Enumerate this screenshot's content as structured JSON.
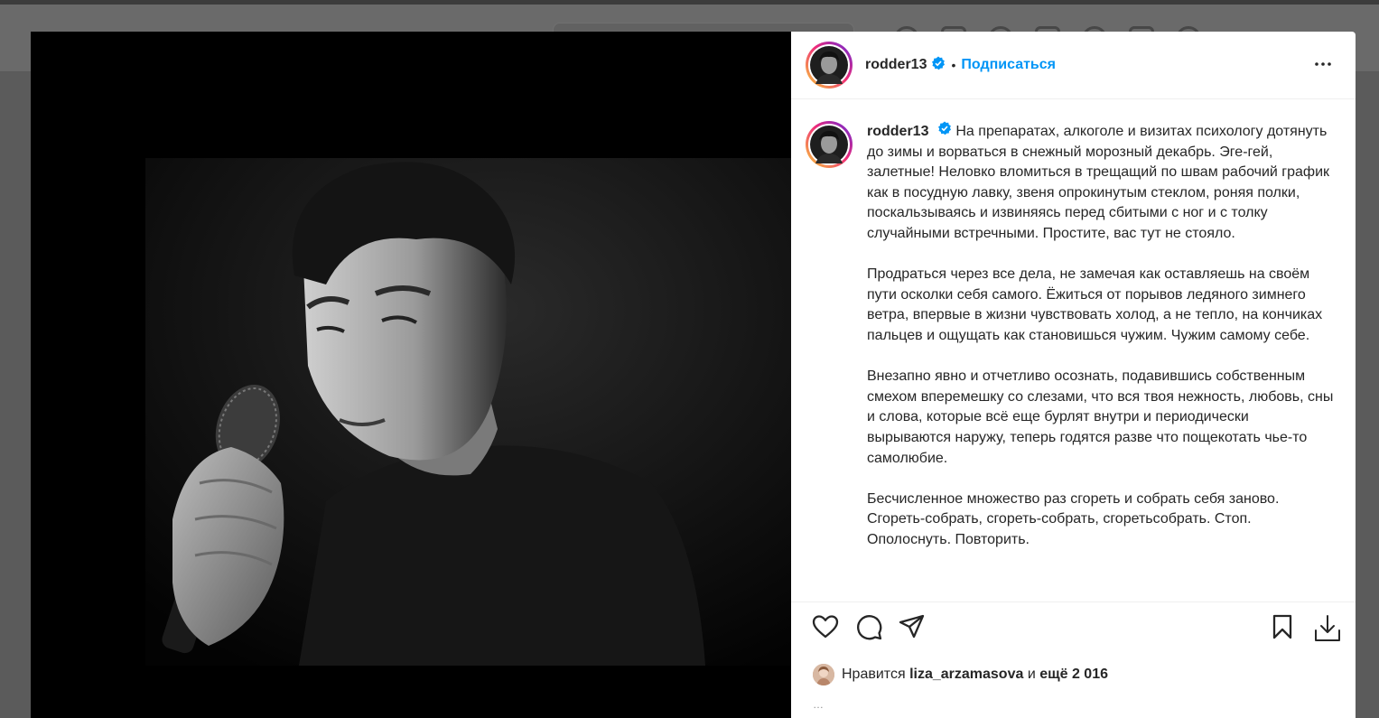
{
  "post": {
    "username": "rodder13",
    "separator": "•",
    "follow_label": "Подписаться",
    "caption_username": "rodder13",
    "caption_paragraphs": [
      "На препаратах, алкоголе и визитах психологу дотянуть до зимы и ворваться в снежный морозный декабрь. Эге-гей, залетные! Неловко вломиться в трещащий по швам рабочий график как в посудную лавку, звеня опрокинутым стеклом, роняя полки, поскальзываясь и извиняясь перед сбитыми с ног и с толку случайными встречными. Простите, вас тут не стояло.",
      "Продраться через все дела, не замечая как оставляешь на своём пути осколки себя самого. Ёжиться от порывов ледяного зимнего ветра, впервые в жизни чувствовать холод, а не тепло, на кончиках пальцев и ощущать как становишься чужим. Чужим самому себе.",
      "Внезапно явно и отчетливо осознать, подавившись собственным смехом вперемешку со слезами, что вся твоя нежность, любовь, сны и слова, которые всё еще бурлят внутри и периодически вырываются наружу, теперь годятся разве что пощекотать чье-то самолюбие.",
      "Бесчисленное множество раз сгореть и собрать себя заново. Сгореть-собрать, сгореть-собрать, сгоретьсобрать. Стоп. Ополоснуть. Повторить."
    ],
    "likes_prefix": "Нравится",
    "likes_user": "liza_arzamasova",
    "likes_and": "и",
    "likes_more": "ещё 2 016",
    "time_partial": "…"
  },
  "icons": {
    "verified": "verified-badge-icon",
    "more": "more-options-icon",
    "like": "heart-icon",
    "comment": "comment-icon",
    "share": "share-icon",
    "save": "bookmark-icon",
    "download": "download-icon"
  },
  "colors": {
    "accent": "#0095f6",
    "text": "#262626",
    "muted": "#8e8e8e"
  }
}
